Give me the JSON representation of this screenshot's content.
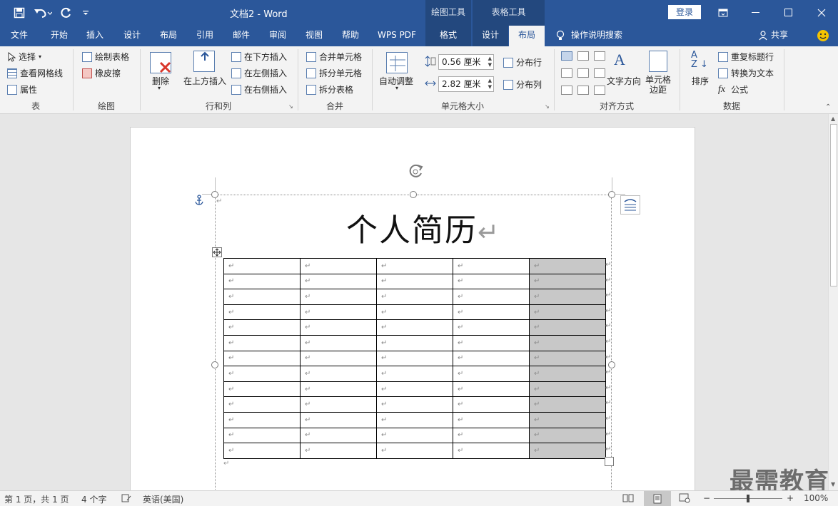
{
  "app": {
    "doc_title": "文档2  -  Word"
  },
  "qat": {
    "save": "save-icon",
    "undo": "undo-icon",
    "redo": "redo-icon",
    "customize": "customize-icon"
  },
  "context_groups": {
    "drawing_tools": "绘图工具",
    "table_tools": "表格工具"
  },
  "login_label": "登录",
  "tabs": [
    "文件",
    "开始",
    "插入",
    "设计",
    "布局",
    "引用",
    "邮件",
    "审阅",
    "视图",
    "帮助",
    "WPS PDF",
    "格式",
    "设计",
    "布局"
  ],
  "tell_me": "操作说明搜索",
  "share": "共享",
  "ribbon": {
    "table": {
      "select": "选择",
      "gridlines": "查看网格线",
      "properties": "属性",
      "label": "表"
    },
    "draw": {
      "draw_table": "绘制表格",
      "eraser": "橡皮擦",
      "label": "绘图"
    },
    "rows_cols": {
      "delete": "删除",
      "insert_above": "在上方插入",
      "insert_below": "在下方插入",
      "insert_left": "在左侧插入",
      "insert_right": "在右侧插入",
      "label": "行和列"
    },
    "merge": {
      "merge_cells": "合并单元格",
      "split_cells": "拆分单元格",
      "split_table": "拆分表格",
      "label": "合并"
    },
    "cell_size": {
      "autofit": "自动调整",
      "height": "0.56 厘米",
      "width": "2.82 厘米",
      "dist_rows": "分布行",
      "dist_cols": "分布列",
      "label": "单元格大小"
    },
    "alignment": {
      "text_direction": "文字方向",
      "cell_margins": "单元格\n边距",
      "label": "对齐方式"
    },
    "data": {
      "sort": "排序",
      "repeat_header": "重复标题行",
      "convert_text": "转换为文本",
      "formula": "公式",
      "label": "数据"
    }
  },
  "document": {
    "title": "个人简历",
    "return_mark": "↵",
    "rows": 13,
    "cols": 5
  },
  "status": {
    "page": "第 1 页，共 1 页",
    "words": "4 个字",
    "language": "英语(美国)",
    "zoom": "100%"
  },
  "watermark": "最需教育"
}
